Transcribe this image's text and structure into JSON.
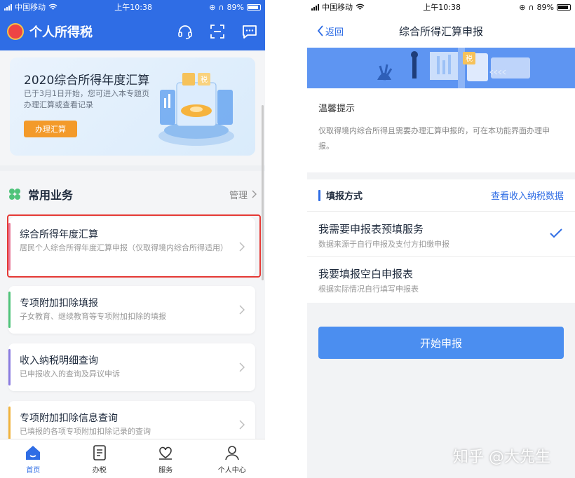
{
  "left": {
    "status": {
      "carrier": "中国移动",
      "time": "上午10:38",
      "battery": "89%"
    },
    "header": {
      "title": "个人所得税"
    },
    "banner": {
      "title": "2020综合所得年度汇算",
      "desc": "已于3月1日开始，您可进入本专题页办理汇算或查看记录",
      "button": "办理汇算",
      "art_tag": "税"
    },
    "services": {
      "title": "常用业务",
      "manage": "管理",
      "items": [
        {
          "title": "综合所得年度汇算",
          "desc": "居民个人综合所得年度汇算申报（仅取得境内综合所得适用）",
          "color": "#e97a9a"
        },
        {
          "title": "专项附加扣除填报",
          "desc": "子女教育、继续教育等专项附加扣除的填报",
          "color": "#4fc37a"
        },
        {
          "title": "收入纳税明细查询",
          "desc": "已申报收入的查询及异议申诉",
          "color": "#8a7be0"
        },
        {
          "title": "专项附加扣除信息查询",
          "desc": "已填报的各项专项附加扣除记录的查询",
          "color": "#f0b23c"
        }
      ]
    },
    "tabbar": [
      {
        "label": "首页",
        "icon": "home-icon",
        "active": true
      },
      {
        "label": "办税",
        "icon": "document-icon",
        "active": false
      },
      {
        "label": "服务",
        "icon": "heart-hand-icon",
        "active": false
      },
      {
        "label": "个人中心",
        "icon": "user-icon",
        "active": false
      }
    ],
    "accent_color": "#2f6de5"
  },
  "right": {
    "status": {
      "carrier": "中国移动",
      "time": "上午10:38",
      "battery": "89%"
    },
    "nav": {
      "back": "返回",
      "title": "综合所得汇算申报"
    },
    "hero": {
      "tag": "税"
    },
    "tips": {
      "title": "温馨提示",
      "body": "仅取得境内综合所得且需要办理汇算申报的，可在本功能界面办理申报。"
    },
    "method": {
      "title": "填报方式",
      "link": "查看收入纳税数据",
      "options": [
        {
          "title": "我需要申报表预填服务",
          "desc": "数据来源于自行申报及支付方扣缴申报",
          "selected": true
        },
        {
          "title": "我要填报空白申报表",
          "desc": "根据实际情况自行填写申报表",
          "selected": false
        }
      ]
    },
    "start_button": "开始申报"
  },
  "watermark": "知乎 @大先生"
}
